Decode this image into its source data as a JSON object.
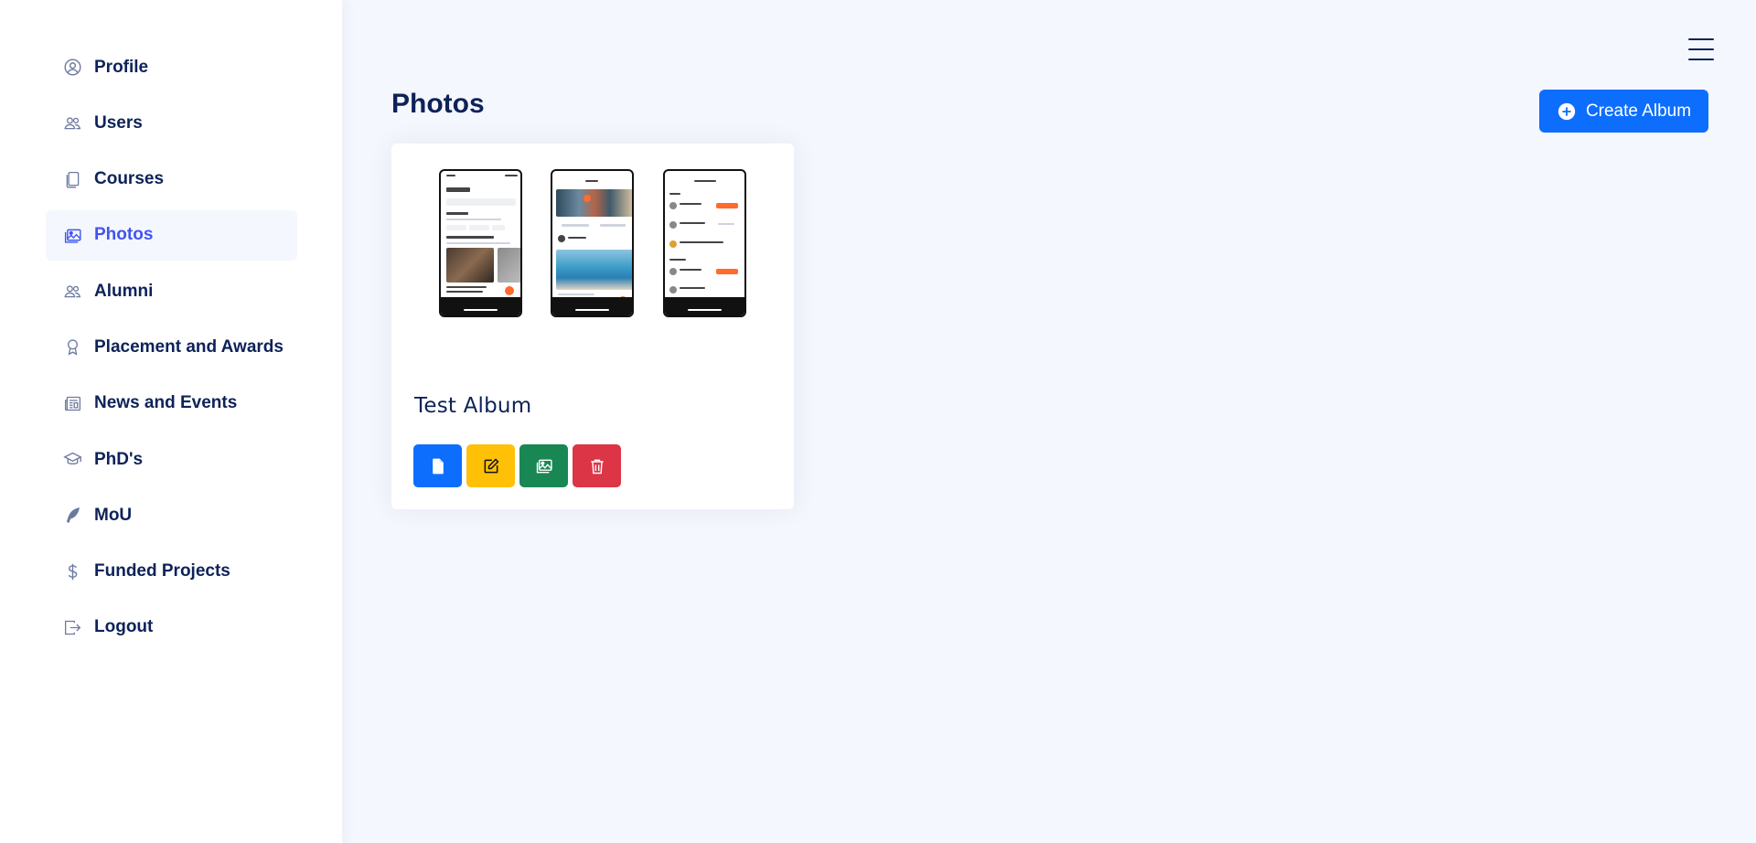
{
  "sidebar": {
    "items": [
      {
        "label": "Profile",
        "icon": "person-circle-icon"
      },
      {
        "label": "Users",
        "icon": "people-icon"
      },
      {
        "label": "Courses",
        "icon": "journals-icon"
      },
      {
        "label": "Photos",
        "icon": "images-icon",
        "active": true
      },
      {
        "label": "Alumni",
        "icon": "people-icon"
      },
      {
        "label": "Placement and Awards",
        "icon": "award-icon"
      },
      {
        "label": "News and Events",
        "icon": "newspaper-icon"
      },
      {
        "label": "PhD's",
        "icon": "mortarboard-icon"
      },
      {
        "label": "MoU",
        "icon": "feather-icon"
      },
      {
        "label": "Funded Projects",
        "icon": "dollar-icon"
      },
      {
        "label": "Logout",
        "icon": "box-arrow-right-icon"
      }
    ]
  },
  "header": {
    "menu_icon": "hamburger-icon"
  },
  "main": {
    "title": "Photos",
    "create_button": {
      "label": "Create Album",
      "icon": "plus-circle-icon"
    },
    "albums": [
      {
        "name": "Test Album",
        "actions": [
          {
            "name": "view",
            "icon": "file-icon",
            "color": "#0d6efd"
          },
          {
            "name": "edit",
            "icon": "pencil-square-icon",
            "color": "#ffc107"
          },
          {
            "name": "photos",
            "icon": "images-icon",
            "color": "#198754"
          },
          {
            "name": "delete",
            "icon": "trash-icon",
            "color": "#dc3545"
          }
        ]
      }
    ]
  },
  "colors": {
    "accent": "#4154f1",
    "primary": "#0d6efd",
    "text": "#0e2259",
    "background": "#f4f7fd"
  }
}
